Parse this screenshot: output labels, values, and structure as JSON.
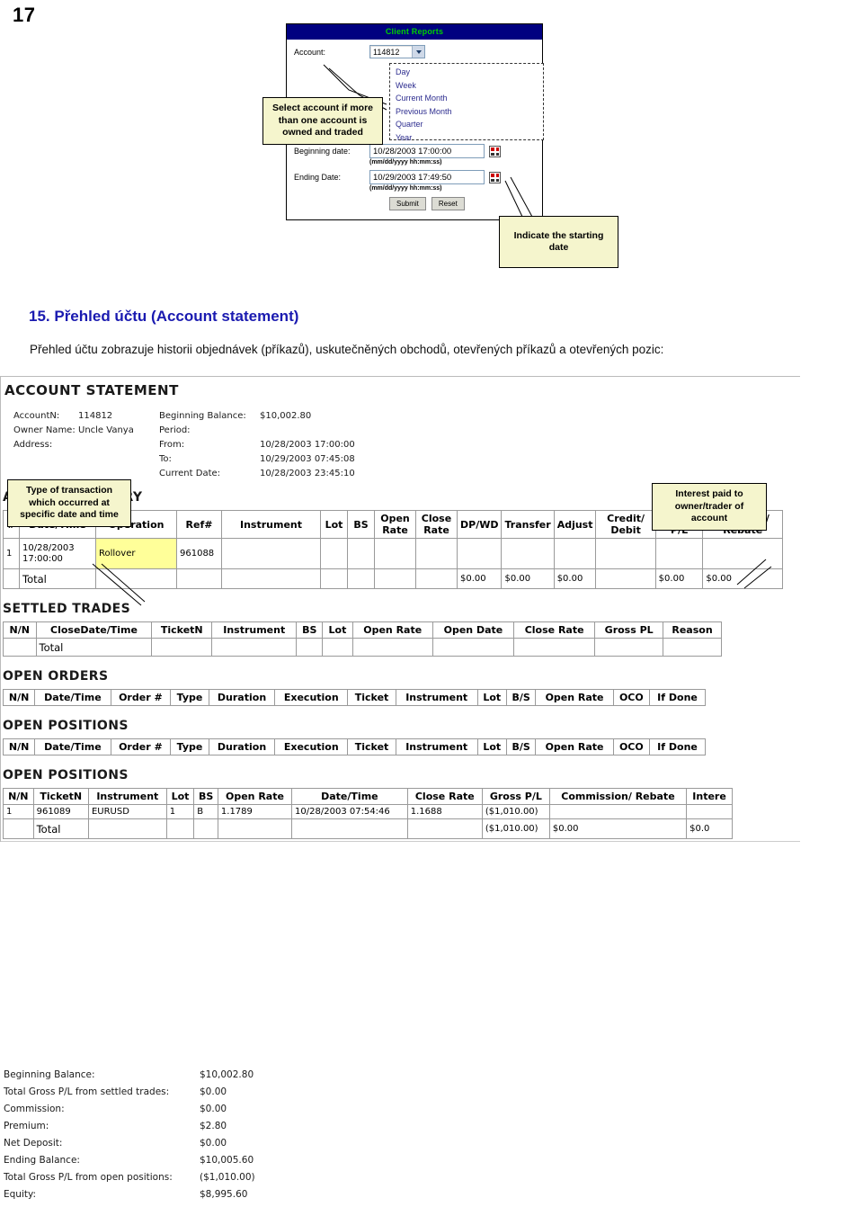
{
  "page": {
    "number": "17"
  },
  "client_reports": {
    "title": "Client Reports",
    "account_label": "Account:",
    "account_value": "114812",
    "period_options": [
      "Day",
      "Week",
      "Current Month",
      "Previous Month",
      "Quarter",
      "Year"
    ],
    "beginning_label": "Beginning date:",
    "beginning_value": "10/28/2003 17:00:00",
    "beginning_format": "(mm/dd/yyyy hh:mm:ss)",
    "ending_label": "Ending Date:",
    "ending_value": "10/29/2003 17:49:50",
    "ending_format": "(mm/dd/yyyy hh:mm:ss)",
    "submit_label": "Submit",
    "reset_label": "Reset",
    "title_bg": "#000080",
    "title_fg": "#00d000"
  },
  "callouts": {
    "select_account": "Select account if more than one account is owned and traded",
    "starting_date": "Indicate the starting date",
    "type_of_transaction": "Type of transaction which occurred at specific date and time",
    "interest_paid": "Interest paid to owner/trader of account"
  },
  "section": {
    "title": "15. Přehled účtu (Account statement)",
    "paragraph": "Přehled účtu zobrazuje historii objednávek (příkazů), uskutečněných obchodů, otevřených příkazů a otevřených pozic:"
  },
  "statement": {
    "heading": "ACCOUNT STATEMENT",
    "account_n_label": "AccountN:",
    "account_n_value": "114812",
    "owner_label": "Owner Name:",
    "owner_value": "Uncle Vanya",
    "address_label": "Address:",
    "address_value": "",
    "beginning_balance_label": "Beginning Balance:",
    "beginning_balance_value": "$10,002.80",
    "period_label": "Period:",
    "from_label": "From:",
    "from_value": "10/28/2003 17:00:00",
    "to_label": "To:",
    "to_value": "10/29/2003 07:45:08",
    "current_date_label": "Current Date:",
    "current_date_value": "10/28/2003 23:45:10",
    "history": {
      "heading": "ACCOUNT HISTORY",
      "columns": [
        "#",
        "Date/Time",
        "Operation",
        "Ref#",
        "Instrument",
        "Lot",
        "BS",
        "Open Rate",
        "Close Rate",
        "DP/WD",
        "Transfer",
        "Adjust",
        "Credit/ Debit",
        "Gross P/L",
        "Commiss/ Rebate"
      ],
      "rows": [
        {
          "n": "1",
          "datetime": "10/28/2003 17:00:00",
          "operation": "Rollover",
          "ref": "961088",
          "instrument": "",
          "lot": "",
          "bs": "",
          "open_rate": "",
          "close_rate": "",
          "dpwd": "",
          "transfer": "",
          "adjust": "",
          "credit_debit": "",
          "gross_pl": "",
          "commission": ""
        }
      ],
      "total_label": "Total",
      "totals": {
        "dpwd": "$0.00",
        "transfer": "$0.00",
        "adjust": "$0.00",
        "credit_debit": "",
        "gross_pl": "$0.00",
        "commission": "$0.00"
      }
    },
    "settled": {
      "heading": "SETTLED TRADES",
      "columns": [
        "N/N",
        "CloseDate/Time",
        "TicketN",
        "Instrument",
        "BS",
        "Lot",
        "Open Rate",
        "Open Date",
        "Close Rate",
        "Gross PL",
        "Reason"
      ],
      "rows": [],
      "total_label": "Total"
    },
    "open_orders": {
      "heading": "OPEN ORDERS",
      "columns": [
        "N/N",
        "Date/Time",
        "Order #",
        "Type",
        "Duration",
        "Execution",
        "Ticket",
        "Instrument",
        "Lot",
        "B/S",
        "Open Rate",
        "OCO",
        "If Done"
      ],
      "rows": []
    },
    "open_positions_orders": {
      "heading": "OPEN POSITIONS",
      "columns": [
        "N/N",
        "Date/Time",
        "Order #",
        "Type",
        "Duration",
        "Execution",
        "Ticket",
        "Instrument",
        "Lot",
        "B/S",
        "Open Rate",
        "OCO",
        "If Done"
      ],
      "rows": []
    },
    "open_positions": {
      "heading": "OPEN POSITIONS",
      "columns": [
        "N/N",
        "TicketN",
        "Instrument",
        "Lot",
        "BS",
        "Open Rate",
        "Date/Time",
        "Close Rate",
        "Gross P/L",
        "Commission/ Rebate",
        "Intere"
      ],
      "rows": [
        {
          "n": "1",
          "ticket": "961089",
          "instrument": "EURUSD",
          "lot": "1",
          "bs": "B",
          "open_rate": "1.1789",
          "datetime": "10/28/2003 07:54:46",
          "close_rate": "1.1688",
          "gross_pl": "($1,010.00)",
          "commission": "",
          "interest": ""
        }
      ],
      "total_label": "Total",
      "totals": {
        "gross_pl": "($1,010.00)",
        "commission": "$0.00",
        "interest": "$0.0"
      }
    },
    "summary": [
      {
        "label": "Beginning Balance:",
        "value": "$10,002.80"
      },
      {
        "label": "Total Gross P/L from settled trades:",
        "value": "$0.00"
      },
      {
        "label": "Commission:",
        "value": "$0.00"
      },
      {
        "label": "Premium:",
        "value": "$2.80"
      },
      {
        "label": "Net Deposit:",
        "value": "$0.00"
      },
      {
        "label": "Ending Balance:",
        "value": "$10,005.60"
      },
      {
        "label": "Total Gross P/L from open positions:",
        "value": "($1,010.00)"
      },
      {
        "label": "Equity:",
        "value": "$8,995.60"
      }
    ]
  }
}
